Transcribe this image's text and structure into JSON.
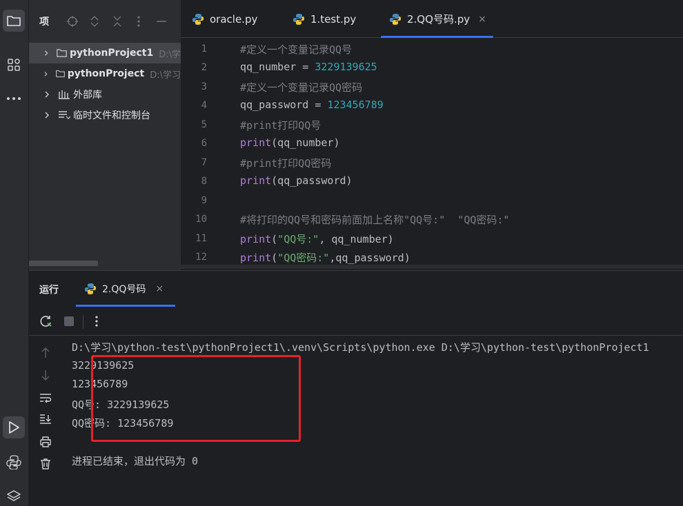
{
  "project_panel": {
    "title": "项",
    "items": [
      {
        "label": "pythonProject1",
        "path": "D:\\学",
        "icon": "folder-icon"
      },
      {
        "label": "pythonProject",
        "path": "D:\\学习",
        "icon": "folder-icon"
      },
      {
        "label": "外部库",
        "icon": "library-icon"
      },
      {
        "label": "临时文件和控制台",
        "icon": "scratch-icon"
      }
    ]
  },
  "editor_tabs": [
    {
      "label": "oracle.py",
      "icon": "python-file-icon"
    },
    {
      "label": "1.test.py",
      "icon": "python-file-icon"
    },
    {
      "label": "2.QQ号码.py",
      "icon": "python-file-icon",
      "active": true,
      "close": "×"
    }
  ],
  "editor": {
    "line_numbers": [
      "1",
      "2",
      "3",
      "4",
      "5",
      "6",
      "7",
      "8",
      "9",
      "10",
      "11",
      "12"
    ],
    "lines": [
      {
        "comment": "#定义一个变量记录QQ号"
      },
      {
        "pre": "qq_number = ",
        "num": "3229139625"
      },
      {
        "comment": "#定义一个变量记录QQ密码"
      },
      {
        "pre": "qq_password = ",
        "num": "123456789"
      },
      {
        "comment": "#print打印QQ号"
      },
      {
        "fn": "print",
        "rest": "(qq_number)"
      },
      {
        "comment": "#print打印QQ密码"
      },
      {
        "fn": "print",
        "rest": "(qq_password)"
      },
      {
        "comment": ""
      },
      {
        "comment": "#将打印的QQ号和密码前面加上名称\"QQ号:\"  \"QQ密码:\""
      },
      {
        "fn": "print",
        "open": "(",
        "str": "\"QQ号:\"",
        "rest": ", qq_number)"
      },
      {
        "fn": "print",
        "open": "(",
        "str": "\"QQ密码:\"",
        "rest": ",qq_password)"
      }
    ]
  },
  "run_panel": {
    "title": "运行",
    "tab_label": "2.QQ号码",
    "tab_close": "×",
    "command": "D:\\学习\\python-test\\pythonProject1\\.venv\\Scripts\\python.exe D:\\学习\\python-test\\pythonProject1",
    "output": [
      "3229139625",
      "123456789",
      "QQ号: 3229139625",
      "QQ密码: 123456789"
    ],
    "exit_message": "进程已结束，退出代码为 0"
  },
  "colors": {
    "accent": "#3574f0",
    "highlight_box": "#e5212b"
  }
}
